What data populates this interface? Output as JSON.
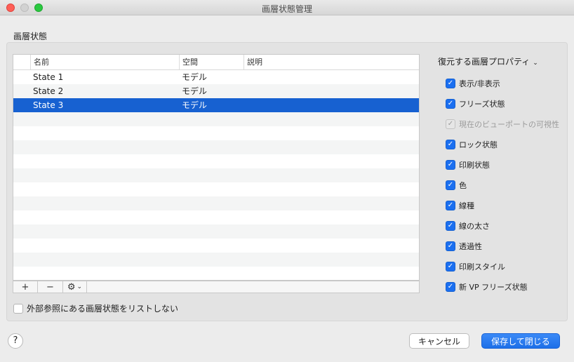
{
  "window": {
    "title": "画層状態管理"
  },
  "section": {
    "label": "画層状態"
  },
  "table": {
    "columns": [
      "名前",
      "空間",
      "説明"
    ],
    "rows": [
      {
        "name": "State 1",
        "space": "モデル",
        "desc": ""
      },
      {
        "name": "State 2",
        "space": "モデル",
        "desc": ""
      },
      {
        "name": "State 3",
        "space": "モデル",
        "desc": ""
      }
    ],
    "selected_index": 2,
    "toolbar": {
      "add": "+",
      "remove": "−",
      "gear": "⚙",
      "gear_chevron": "⌄"
    }
  },
  "props": {
    "header": "復元する画層プロパティ",
    "header_chevron": "⌄",
    "options": [
      {
        "label": "表示/非表示",
        "checked": true,
        "disabled": false
      },
      {
        "label": "フリーズ状態",
        "checked": true,
        "disabled": false
      },
      {
        "label": "現在のビューポートの可視性",
        "checked": true,
        "disabled": true
      },
      {
        "label": "ロック状態",
        "checked": true,
        "disabled": false
      },
      {
        "label": "印刷状態",
        "checked": true,
        "disabled": false
      },
      {
        "label": "色",
        "checked": true,
        "disabled": false
      },
      {
        "label": "線種",
        "checked": true,
        "disabled": false
      },
      {
        "label": "線の太さ",
        "checked": true,
        "disabled": false
      },
      {
        "label": "透過性",
        "checked": true,
        "disabled": false
      },
      {
        "label": "印刷スタイル",
        "checked": true,
        "disabled": false
      },
      {
        "label": "新 VP フリーズ状態",
        "checked": true,
        "disabled": false
      }
    ]
  },
  "external": {
    "label": "外部参照にある画層状態をリストしない",
    "checked": false
  },
  "footer": {
    "help": "?",
    "cancel": "キャンセル",
    "save": "保存して閉じる"
  },
  "colors": {
    "accent": "#1b6ff0",
    "selection": "#1761d1"
  }
}
